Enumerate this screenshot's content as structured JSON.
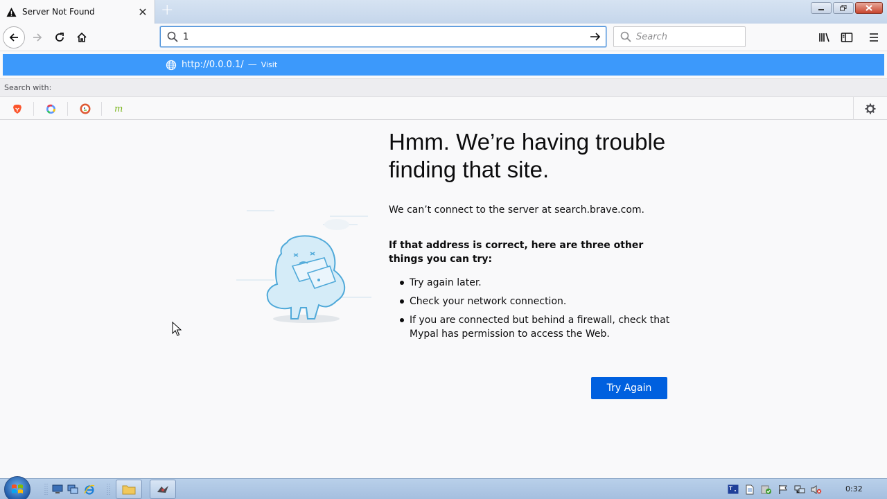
{
  "window": {
    "tab_title": "Server Not Found",
    "new_tab_symbol": "+"
  },
  "navbar": {
    "url_value": "1",
    "search_placeholder": "Search"
  },
  "autocomplete": {
    "suggestion_url": "http://0.0.0.1/",
    "suggestion_separator": "—",
    "suggestion_action": "Visit",
    "search_with_label": "Search with:",
    "engines": [
      "brave-icon",
      "qwant-icon",
      "duckduckgo-icon",
      "mojeek-icon"
    ]
  },
  "error_page": {
    "title": "Hmm. We’re having trouble finding that site.",
    "description": "We can’t connect to the server at search.brave.com.",
    "hint": "If that address is correct, here are three other things you can try:",
    "suggestions": [
      "Try again later.",
      "Check your network connection.",
      "If you are connected but behind a firewall, check that Mypal has permission to access the Web."
    ],
    "button_label": "Try Again"
  },
  "taskbar": {
    "clock": "0:32"
  },
  "colors": {
    "accent": "#3c99fb",
    "button": "#0060df"
  }
}
